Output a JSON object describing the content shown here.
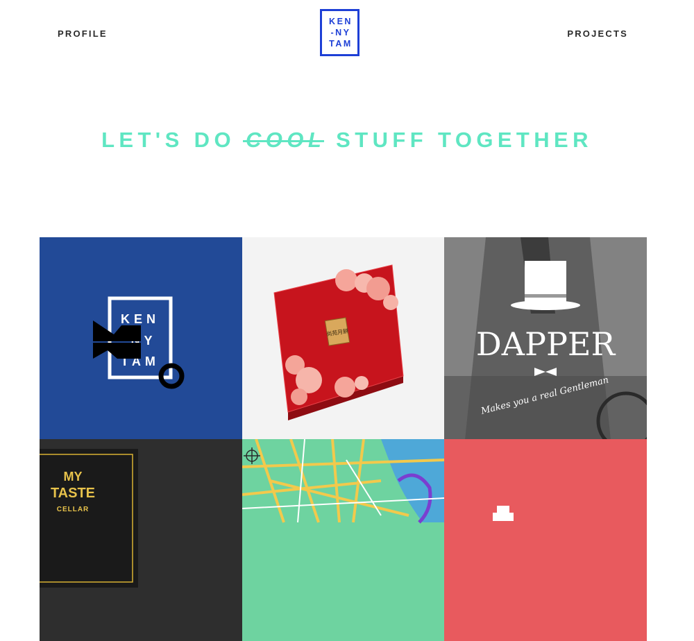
{
  "nav": {
    "profile_label": "PROFILE",
    "projects_label": "PROJECTS",
    "logo_lines": [
      "KEN",
      "-NY",
      "TAM"
    ]
  },
  "hero": {
    "pre": "LET'S DO",
    "struck": "COOL",
    "post": "STUFF TOGETHER",
    "accent_color": "#5fe6c2"
  },
  "colors": {
    "logo_blue": "#1d3fd6",
    "tile_blue": "#224a97",
    "tile_red": "#e85a5e",
    "tile_dark": "#2e2e2e"
  },
  "projects": [
    {
      "id": "kennytam-identity",
      "logo_lines": [
        "KEN",
        "NY",
        "TAM"
      ]
    },
    {
      "id": "mooncake-box",
      "box_label": "尚苑月餅"
    },
    {
      "id": "dapper",
      "title": "DAPPER",
      "tagline": "Makes you a real Gentleman"
    },
    {
      "id": "my-taste-cellar",
      "line1": "MY",
      "line2": "TASTE",
      "line3": "CELLAR"
    },
    {
      "id": "illustrated-map"
    },
    {
      "id": "red-project"
    }
  ]
}
